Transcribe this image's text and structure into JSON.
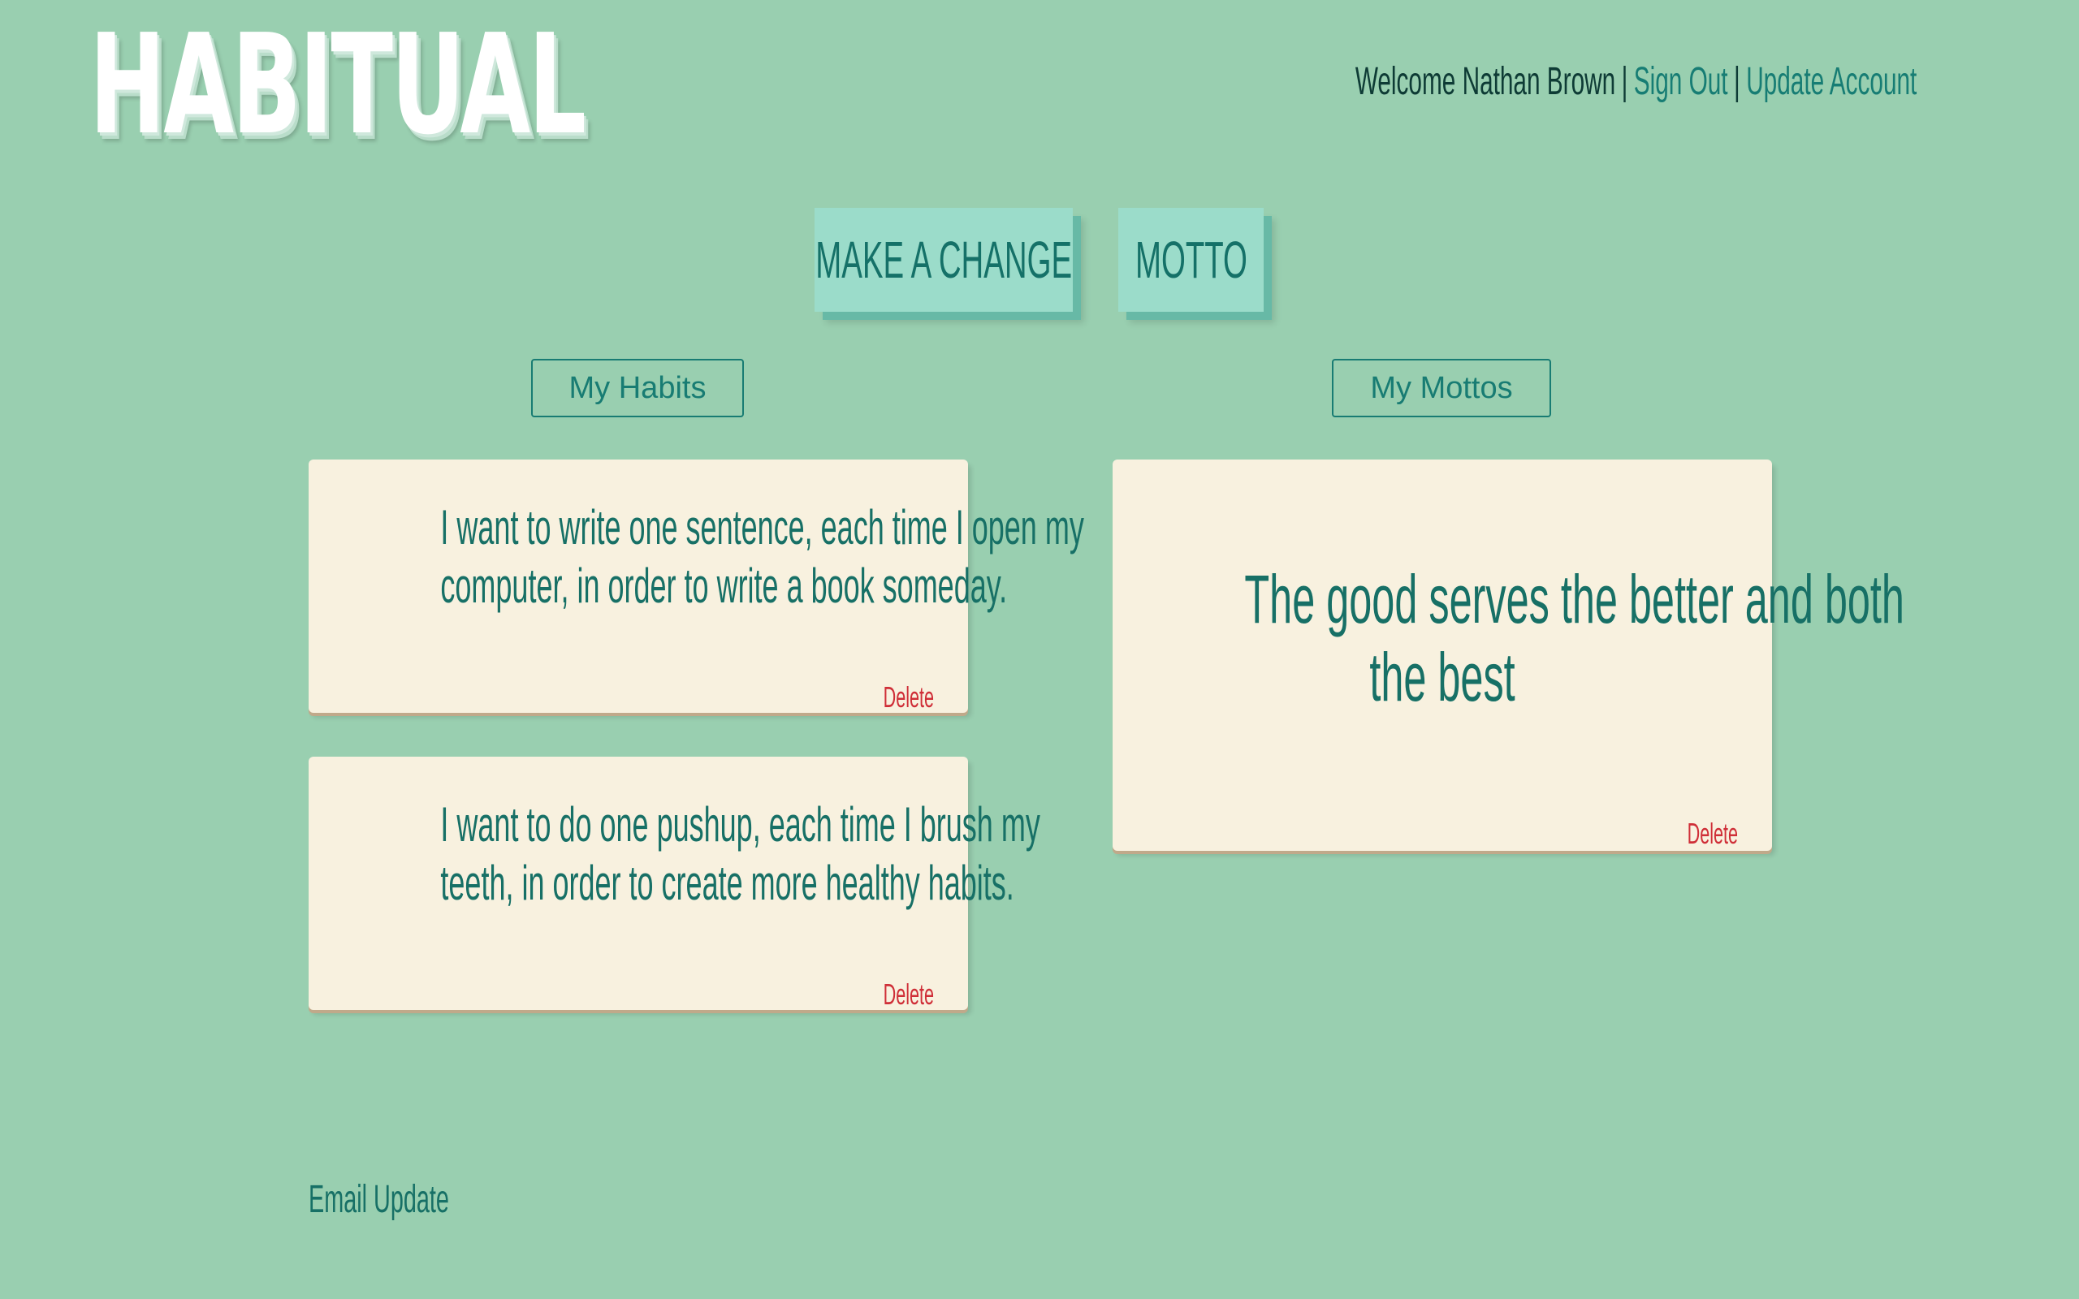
{
  "logo": {
    "text": "HABITUAL"
  },
  "user_bar": {
    "welcome": "Welcome Nathan Brown",
    "sign_out": "Sign Out",
    "update_account": "Update Account",
    "separator": "|"
  },
  "nav": {
    "make_change": "MAKE A CHANGE",
    "motto": "MOTTO"
  },
  "habits_section": {
    "button_label": "My Habits",
    "items": [
      {
        "line1": "I want to write one sentence, each time I open my",
        "line2": "computer, in order to write a book someday.",
        "delete_label": "Delete"
      },
      {
        "line1": "I want to do one pushup, each time I brush my",
        "line2": "teeth, in order to create more healthy habits.",
        "delete_label": "Delete"
      }
    ]
  },
  "mottos_section": {
    "button_label": "My Mottos",
    "items": [
      {
        "line1": "The good serves the better and both",
        "line2": "the best",
        "delete_label": "Delete"
      }
    ]
  },
  "footer": {
    "email_update": "Email Update"
  },
  "colors": {
    "background": "#99cfb0",
    "card": "#f8f1df",
    "accent": "#177066",
    "delete": "#cf2e37",
    "button": "#9bdcca"
  }
}
